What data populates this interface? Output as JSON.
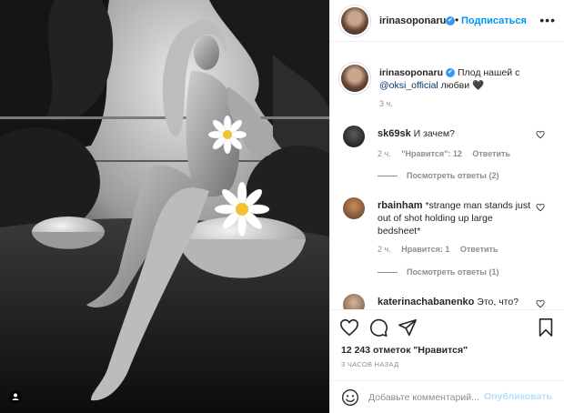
{
  "header": {
    "username": "irinasoponaru",
    "verified_glyph": "✔",
    "separator": "•",
    "follow_label": "Подписаться",
    "more_icon": "more-dots-icon",
    "more_glyph": "•••"
  },
  "caption": {
    "username": "irinasoponaru",
    "text_before": "Плод нашей с ",
    "mention": "@oksi_official",
    "text_after": " любви 🖤",
    "time": "3 ч."
  },
  "comments": [
    {
      "username": "sk69sk",
      "text": "И зачем?",
      "time": "2 ч.",
      "likes": "\"Нравится\": 12",
      "reply": "Ответить",
      "view_replies": "Посмотреть ответы (2)"
    },
    {
      "username": "rbainham",
      "text": "*strange man stands just out of shot holding up large bedsheet*",
      "time": "2 ч.",
      "likes": "Нравится: 1",
      "reply": "Ответить",
      "view_replies": "Посмотреть ответы (1)"
    },
    {
      "username": "katerinachabanenko",
      "text": "Это, что?"
    }
  ],
  "actions": {
    "like_icon": "heart-icon",
    "comment_icon": "comment-icon",
    "share_icon": "share-icon",
    "save_icon": "bookmark-icon",
    "likes": "12 243 отметок \"Нравится\"",
    "post_time": "3 ЧАСОВ НАЗАД"
  },
  "add_comment": {
    "emoji_icon": "emoji-icon",
    "placeholder": "Добавьте комментарий...",
    "publish_label": "Опубликовать"
  },
  "colors": {
    "accent": "#0095f6",
    "publish_disabled": "#b2dffc",
    "muted": "#8e8e8e",
    "verified": "#3897f0"
  }
}
